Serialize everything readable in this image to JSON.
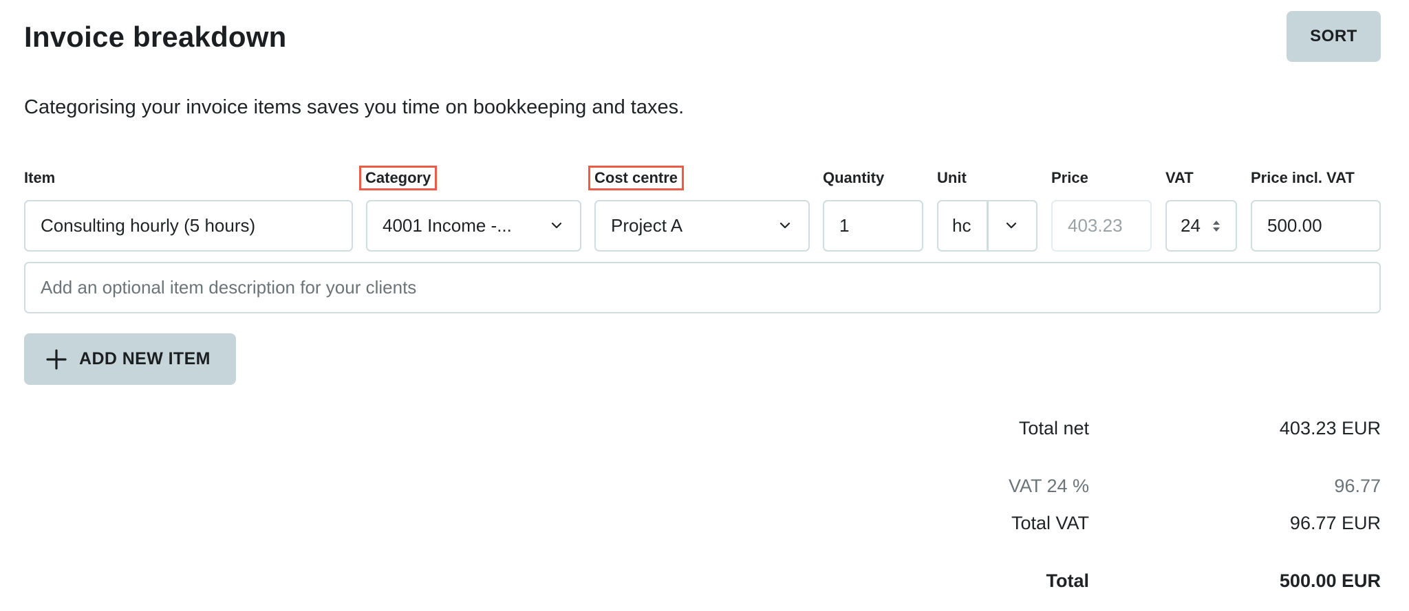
{
  "header": {
    "title": "Invoice breakdown",
    "sort_label": "SORT",
    "subtitle": "Categorising your invoice items saves you time on bookkeeping and taxes."
  },
  "columns": {
    "item": "Item",
    "category": "Category",
    "cost_centre": "Cost centre",
    "quantity": "Quantity",
    "unit": "Unit",
    "price": "Price",
    "vat": "VAT",
    "price_incl_vat": "Price incl. VAT"
  },
  "row": {
    "item": "Consulting hourly (5 hours)",
    "category": "4001 Income -...",
    "cost_centre": "Project A",
    "quantity": "1",
    "unit": "hc",
    "price": "403.23",
    "vat": "24",
    "price_incl_vat": "500.00"
  },
  "description_placeholder": "Add an optional item description for your clients",
  "add_item_label": "ADD NEW ITEM",
  "totals": {
    "total_net_label": "Total net",
    "total_net_value": "403.23 EUR",
    "vat_rate_label": "VAT 24 %",
    "vat_rate_value": "96.77",
    "total_vat_label": "Total VAT",
    "total_vat_value": "96.77 EUR",
    "total_label": "Total",
    "total_value": "500.00 EUR"
  },
  "colors": {
    "accent_button": "#c5d5da",
    "highlight": "#ee5a48",
    "border": "#cfdde1"
  },
  "icons": {
    "dropdown": "chevron-down-icon",
    "spinner": "spinner-arrows-icon",
    "add": "plus-icon"
  }
}
